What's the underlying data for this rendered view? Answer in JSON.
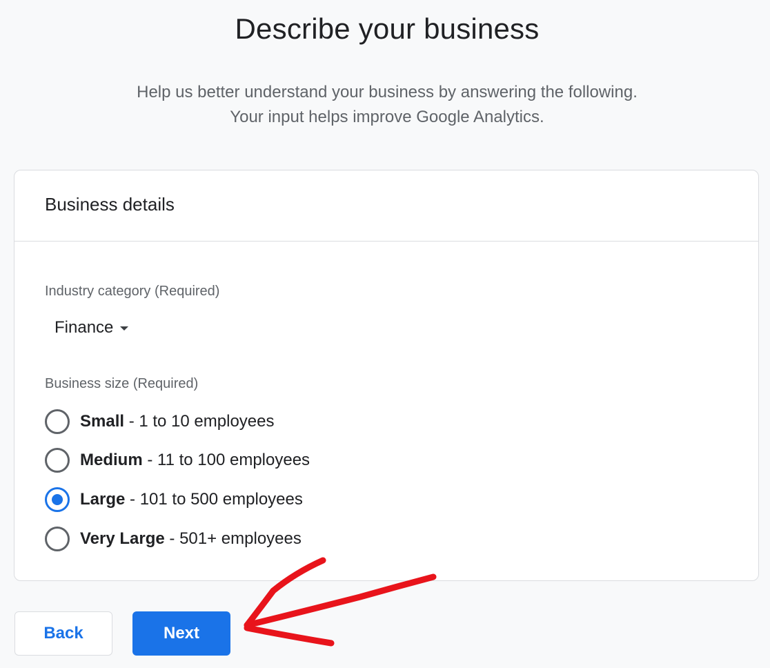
{
  "header": {
    "title": "Describe your business",
    "subtitle_line1": "Help us better understand your business by answering the following.",
    "subtitle_line2": "Your input helps improve Google Analytics."
  },
  "card": {
    "title": "Business details",
    "industry": {
      "label": "Industry category (Required)",
      "selected": "Finance"
    },
    "size": {
      "label": "Business size (Required)",
      "options": [
        {
          "name": "Small",
          "detail": " - 1 to 10 employees",
          "checked": false
        },
        {
          "name": "Medium",
          "detail": " - 11 to 100 employees",
          "checked": false
        },
        {
          "name": "Large",
          "detail": " - 101 to 500 employees",
          "checked": true
        },
        {
          "name": "Very Large",
          "detail": " - 501+ employees",
          "checked": false
        }
      ]
    }
  },
  "buttons": {
    "back": "Back",
    "next": "Next"
  },
  "colors": {
    "accent": "#1a73e8",
    "annotation_arrow": "#e8141b"
  },
  "icons": {
    "dropdown": "caret-down-icon",
    "annotation": "red-arrow-annotation"
  }
}
